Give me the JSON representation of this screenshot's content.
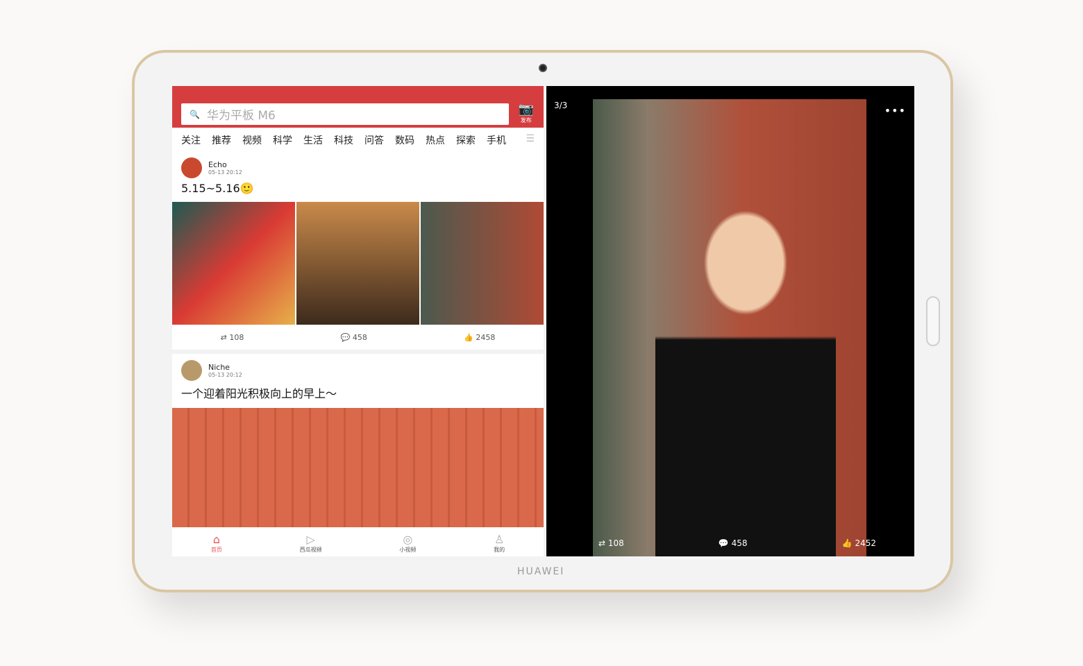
{
  "device": {
    "brand": "HUAWEI"
  },
  "search": {
    "placeholder": "华为平板 M6",
    "post_label": "发布"
  },
  "tabs": [
    "关注",
    "推荐",
    "视频",
    "科学",
    "生活",
    "科技",
    "问答",
    "数码",
    "热点",
    "探索",
    "手机"
  ],
  "posts": [
    {
      "name": "Echo",
      "time": "05-13 20:12",
      "text": "5.15~5.16🙂",
      "reposts": "108",
      "comments": "458",
      "likes": "2458"
    },
    {
      "name": "Niche",
      "time": "05-13 20:12",
      "text": "一个迎着阳光积极向上的早上～"
    }
  ],
  "nav": [
    {
      "label": "首页",
      "icon": "home-icon"
    },
    {
      "label": "西瓜视频",
      "icon": "play-icon"
    },
    {
      "label": "小视频",
      "icon": "video-icon"
    },
    {
      "label": "我的",
      "icon": "user-icon"
    }
  ],
  "viewer": {
    "counter": "3/3",
    "reposts": "108",
    "comments": "458",
    "likes": "2452"
  },
  "colors": {
    "accent": "#d63d3f"
  }
}
